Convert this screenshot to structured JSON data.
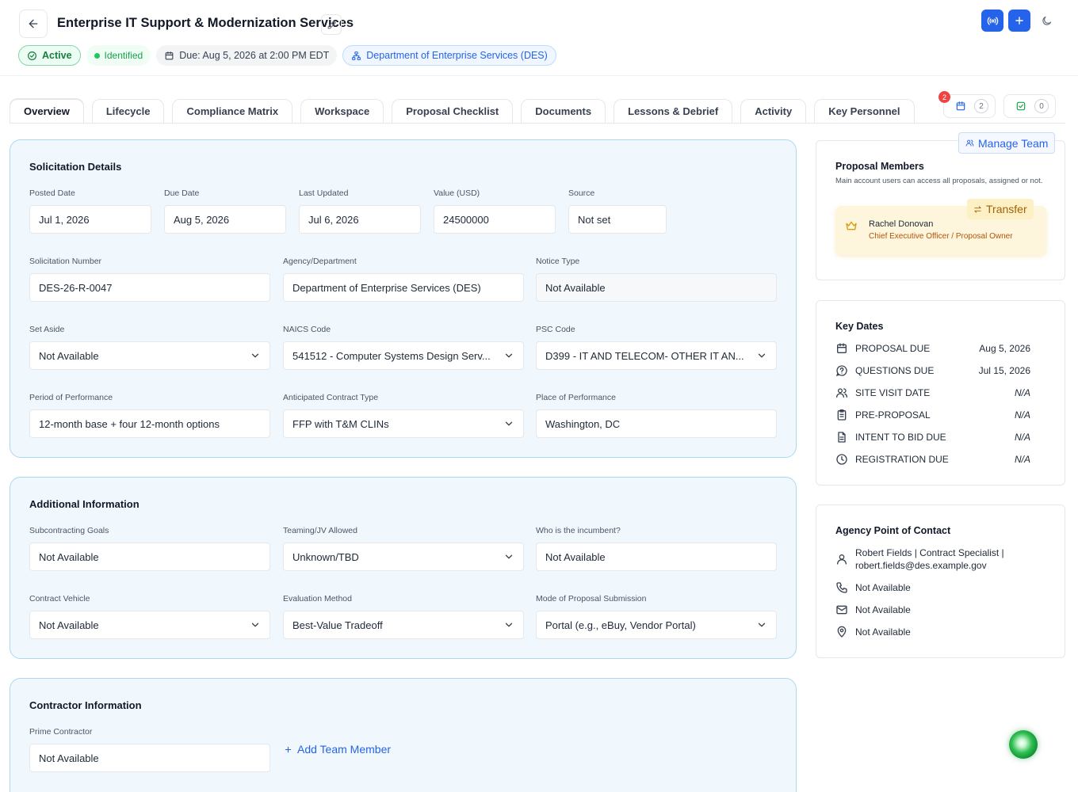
{
  "header": {
    "title": "Enterprise IT Support & Modernization Services",
    "status_label": "Active",
    "stage_label": "Identified",
    "due_label": "Due: Aug 5, 2026 at 2:00 PM EDT",
    "department_label": "Department of Enterprise Services (DES)"
  },
  "tabs": [
    {
      "label": "Overview"
    },
    {
      "label": "Lifecycle"
    },
    {
      "label": "Compliance Matrix"
    },
    {
      "label": "Workspace"
    },
    {
      "label": "Proposal Checklist"
    },
    {
      "label": "Documents"
    },
    {
      "label": "Lessons & Debrief"
    },
    {
      "label": "Activity"
    },
    {
      "label": "Key Personnel"
    }
  ],
  "counters": {
    "calendar_badge": "2",
    "calendar_count": "2",
    "tasks_count": "0"
  },
  "solicitation": {
    "title": "Solicitation Details",
    "posted_date": {
      "label": "Posted Date",
      "value": "Jul 1, 2026"
    },
    "due_date": {
      "label": "Due Date",
      "value": "Aug 5, 2026"
    },
    "last_updated": {
      "label": "Last Updated",
      "value": "Jul 6, 2026"
    },
    "value_usd": {
      "label": "Value (USD)",
      "value": "24500000"
    },
    "source": {
      "label": "Source",
      "value": "Not set"
    },
    "solicitation_number": {
      "label": "Solicitation Number",
      "value": "DES-26-R-0047"
    },
    "agency": {
      "label": "Agency/Department",
      "value": "Department of Enterprise Services (DES)"
    },
    "notice_type": {
      "label": "Notice Type",
      "value": "Not Available"
    },
    "set_aside": {
      "label": "Set Aside",
      "value": "Not Available"
    },
    "naics": {
      "label": "NAICS Code",
      "value": "541512 - Computer Systems Design Serv..."
    },
    "psc": {
      "label": "PSC Code",
      "value": "D399 - IT AND TELECOM- OTHER IT AN..."
    },
    "period": {
      "label": "Period of Performance",
      "value": "12-month base + four 12-month options"
    },
    "contract_type": {
      "label": "Anticipated Contract Type",
      "value": "FFP with T&M CLINs"
    },
    "place": {
      "label": "Place of Performance",
      "value": "Washington, DC"
    }
  },
  "additional": {
    "title": "Additional Information",
    "subcontracting": {
      "label": "Subcontracting Goals",
      "value": "Not Available"
    },
    "teaming": {
      "label": "Teaming/JV Allowed",
      "value": "Unknown/TBD"
    },
    "incumbent": {
      "label": "Who is the incumbent?",
      "value": "Not Available"
    },
    "vehicle": {
      "label": "Contract Vehicle",
      "value": "Not Available"
    },
    "evaluation": {
      "label": "Evaluation Method",
      "value": "Best-Value Tradeoff"
    },
    "submission": {
      "label": "Mode of Proposal Submission",
      "value": "Portal (e.g., eBuy, Vendor Portal)"
    }
  },
  "contractor": {
    "title": "Contractor Information",
    "prime": {
      "label": "Prime Contractor",
      "value": "Not Available"
    },
    "add_member_label": "Add Team Member"
  },
  "members": {
    "manage_label": "Manage Team",
    "title": "Proposal Members",
    "subtitle": "Main account users can access all proposals, assigned or not.",
    "transfer_label": "Transfer",
    "owner_name": "Rachel Donovan",
    "owner_role": "Chief Executive Officer / Proposal Owner"
  },
  "key_dates": {
    "title": "Key Dates",
    "items": [
      {
        "label": "PROPOSAL DUE",
        "date": "Aug 5, 2026",
        "icon": "calendar-icon"
      },
      {
        "label": "QUESTIONS DUE",
        "date": "Jul 15, 2026",
        "icon": "question-icon"
      },
      {
        "label": "SITE VISIT DATE",
        "date": "N/A",
        "icon": "users-icon"
      },
      {
        "label": "PRE-PROPOSAL",
        "date": "N/A",
        "icon": "clipboard-icon"
      },
      {
        "label": "INTENT TO BID DUE",
        "date": "N/A",
        "icon": "document-icon"
      },
      {
        "label": "REGISTRATION DUE",
        "date": "N/A",
        "icon": "clock-icon"
      }
    ]
  },
  "poc": {
    "title": "Agency Point of Contact",
    "contact_line1": "Robert Fields | Contract Specialist |",
    "contact_line2": "robert.fields@des.example.gov",
    "phone": "Not Available",
    "email": "Not Available",
    "address": "Not Available"
  }
}
